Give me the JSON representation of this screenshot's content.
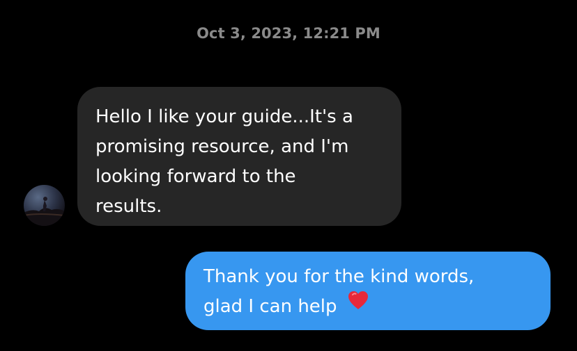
{
  "timestamp": "Oct 3, 2023, 12:21 PM",
  "messages": [
    {
      "direction": "received",
      "lines": [
        "Hello I like your guide...It's a",
        "promising resource, and I'm",
        "looking forward to the",
        "results."
      ],
      "avatar_icon": "user-avatar"
    },
    {
      "direction": "sent",
      "lines": [
        "Thank you for the kind words,",
        "glad I can help"
      ],
      "emoji_icon": "red-heart-icon"
    }
  ],
  "colors": {
    "background": "#000000",
    "received_bubble": "#262626",
    "sent_bubble": "#3797f0",
    "timestamp_text": "#8a8a8a",
    "heart": "#e8283a"
  }
}
